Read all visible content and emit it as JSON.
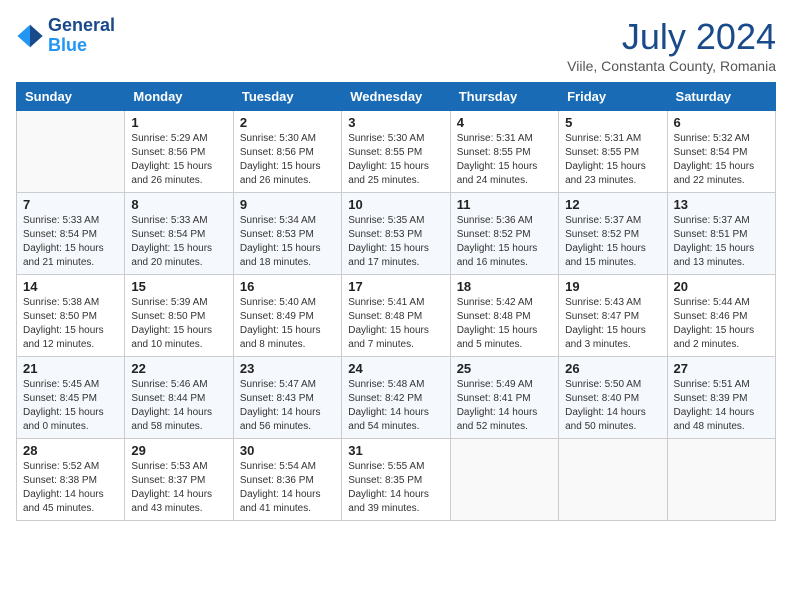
{
  "logo": {
    "line1": "General",
    "line2": "Blue"
  },
  "title": "July 2024",
  "location": "Viile, Constanta County, Romania",
  "weekdays": [
    "Sunday",
    "Monday",
    "Tuesday",
    "Wednesday",
    "Thursday",
    "Friday",
    "Saturday"
  ],
  "weeks": [
    [
      {
        "day": "",
        "info": ""
      },
      {
        "day": "1",
        "info": "Sunrise: 5:29 AM\nSunset: 8:56 PM\nDaylight: 15 hours\nand 26 minutes."
      },
      {
        "day": "2",
        "info": "Sunrise: 5:30 AM\nSunset: 8:56 PM\nDaylight: 15 hours\nand 26 minutes."
      },
      {
        "day": "3",
        "info": "Sunrise: 5:30 AM\nSunset: 8:55 PM\nDaylight: 15 hours\nand 25 minutes."
      },
      {
        "day": "4",
        "info": "Sunrise: 5:31 AM\nSunset: 8:55 PM\nDaylight: 15 hours\nand 24 minutes."
      },
      {
        "day": "5",
        "info": "Sunrise: 5:31 AM\nSunset: 8:55 PM\nDaylight: 15 hours\nand 23 minutes."
      },
      {
        "day": "6",
        "info": "Sunrise: 5:32 AM\nSunset: 8:54 PM\nDaylight: 15 hours\nand 22 minutes."
      }
    ],
    [
      {
        "day": "7",
        "info": "Sunrise: 5:33 AM\nSunset: 8:54 PM\nDaylight: 15 hours\nand 21 minutes."
      },
      {
        "day": "8",
        "info": "Sunrise: 5:33 AM\nSunset: 8:54 PM\nDaylight: 15 hours\nand 20 minutes."
      },
      {
        "day": "9",
        "info": "Sunrise: 5:34 AM\nSunset: 8:53 PM\nDaylight: 15 hours\nand 18 minutes."
      },
      {
        "day": "10",
        "info": "Sunrise: 5:35 AM\nSunset: 8:53 PM\nDaylight: 15 hours\nand 17 minutes."
      },
      {
        "day": "11",
        "info": "Sunrise: 5:36 AM\nSunset: 8:52 PM\nDaylight: 15 hours\nand 16 minutes."
      },
      {
        "day": "12",
        "info": "Sunrise: 5:37 AM\nSunset: 8:52 PM\nDaylight: 15 hours\nand 15 minutes."
      },
      {
        "day": "13",
        "info": "Sunrise: 5:37 AM\nSunset: 8:51 PM\nDaylight: 15 hours\nand 13 minutes."
      }
    ],
    [
      {
        "day": "14",
        "info": "Sunrise: 5:38 AM\nSunset: 8:50 PM\nDaylight: 15 hours\nand 12 minutes."
      },
      {
        "day": "15",
        "info": "Sunrise: 5:39 AM\nSunset: 8:50 PM\nDaylight: 15 hours\nand 10 minutes."
      },
      {
        "day": "16",
        "info": "Sunrise: 5:40 AM\nSunset: 8:49 PM\nDaylight: 15 hours\nand 8 minutes."
      },
      {
        "day": "17",
        "info": "Sunrise: 5:41 AM\nSunset: 8:48 PM\nDaylight: 15 hours\nand 7 minutes."
      },
      {
        "day": "18",
        "info": "Sunrise: 5:42 AM\nSunset: 8:48 PM\nDaylight: 15 hours\nand 5 minutes."
      },
      {
        "day": "19",
        "info": "Sunrise: 5:43 AM\nSunset: 8:47 PM\nDaylight: 15 hours\nand 3 minutes."
      },
      {
        "day": "20",
        "info": "Sunrise: 5:44 AM\nSunset: 8:46 PM\nDaylight: 15 hours\nand 2 minutes."
      }
    ],
    [
      {
        "day": "21",
        "info": "Sunrise: 5:45 AM\nSunset: 8:45 PM\nDaylight: 15 hours\nand 0 minutes."
      },
      {
        "day": "22",
        "info": "Sunrise: 5:46 AM\nSunset: 8:44 PM\nDaylight: 14 hours\nand 58 minutes."
      },
      {
        "day": "23",
        "info": "Sunrise: 5:47 AM\nSunset: 8:43 PM\nDaylight: 14 hours\nand 56 minutes."
      },
      {
        "day": "24",
        "info": "Sunrise: 5:48 AM\nSunset: 8:42 PM\nDaylight: 14 hours\nand 54 minutes."
      },
      {
        "day": "25",
        "info": "Sunrise: 5:49 AM\nSunset: 8:41 PM\nDaylight: 14 hours\nand 52 minutes."
      },
      {
        "day": "26",
        "info": "Sunrise: 5:50 AM\nSunset: 8:40 PM\nDaylight: 14 hours\nand 50 minutes."
      },
      {
        "day": "27",
        "info": "Sunrise: 5:51 AM\nSunset: 8:39 PM\nDaylight: 14 hours\nand 48 minutes."
      }
    ],
    [
      {
        "day": "28",
        "info": "Sunrise: 5:52 AM\nSunset: 8:38 PM\nDaylight: 14 hours\nand 45 minutes."
      },
      {
        "day": "29",
        "info": "Sunrise: 5:53 AM\nSunset: 8:37 PM\nDaylight: 14 hours\nand 43 minutes."
      },
      {
        "day": "30",
        "info": "Sunrise: 5:54 AM\nSunset: 8:36 PM\nDaylight: 14 hours\nand 41 minutes."
      },
      {
        "day": "31",
        "info": "Sunrise: 5:55 AM\nSunset: 8:35 PM\nDaylight: 14 hours\nand 39 minutes."
      },
      {
        "day": "",
        "info": ""
      },
      {
        "day": "",
        "info": ""
      },
      {
        "day": "",
        "info": ""
      }
    ]
  ]
}
